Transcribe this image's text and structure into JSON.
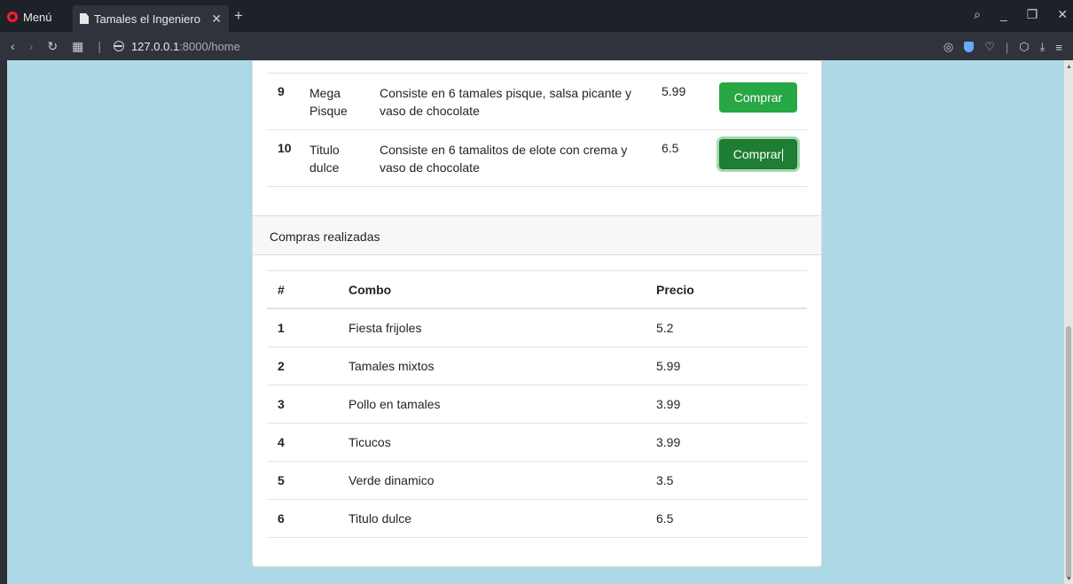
{
  "browser": {
    "menu_label": "Menú",
    "tab_title": "Tamales el Ingeniero",
    "url_host": "127.0.0.1",
    "url_path": ":8000/home"
  },
  "combos": [
    {
      "num": "9",
      "name": "Mega Pisque",
      "description": "Consiste en 6 tamales pisque, salsa picante y vaso de chocolate",
      "price": "5.99",
      "button": "Comprar"
    },
    {
      "num": "10",
      "name": "Titulo dulce",
      "description": "Consiste en 6 tamalitos de elote con crema y vaso de chocolate",
      "price": "6.5",
      "button": "Comprar"
    }
  ],
  "orders": {
    "title": "Compras realizadas",
    "headers": {
      "num": "#",
      "combo": "Combo",
      "price": "Precio"
    },
    "rows": [
      {
        "num": "1",
        "combo": "Fiesta frijoles",
        "price": "5.2"
      },
      {
        "num": "2",
        "combo": "Tamales mixtos",
        "price": "5.99"
      },
      {
        "num": "3",
        "combo": "Pollo en tamales",
        "price": "3.99"
      },
      {
        "num": "4",
        "combo": "Ticucos",
        "price": "3.99"
      },
      {
        "num": "5",
        "combo": "Verde dinamico",
        "price": "3.5"
      },
      {
        "num": "6",
        "combo": "Titulo dulce",
        "price": "6.5"
      }
    ]
  },
  "colors": {
    "page_bg": "#add8e6",
    "button": "#28a745",
    "button_active": "#1e7e34"
  }
}
